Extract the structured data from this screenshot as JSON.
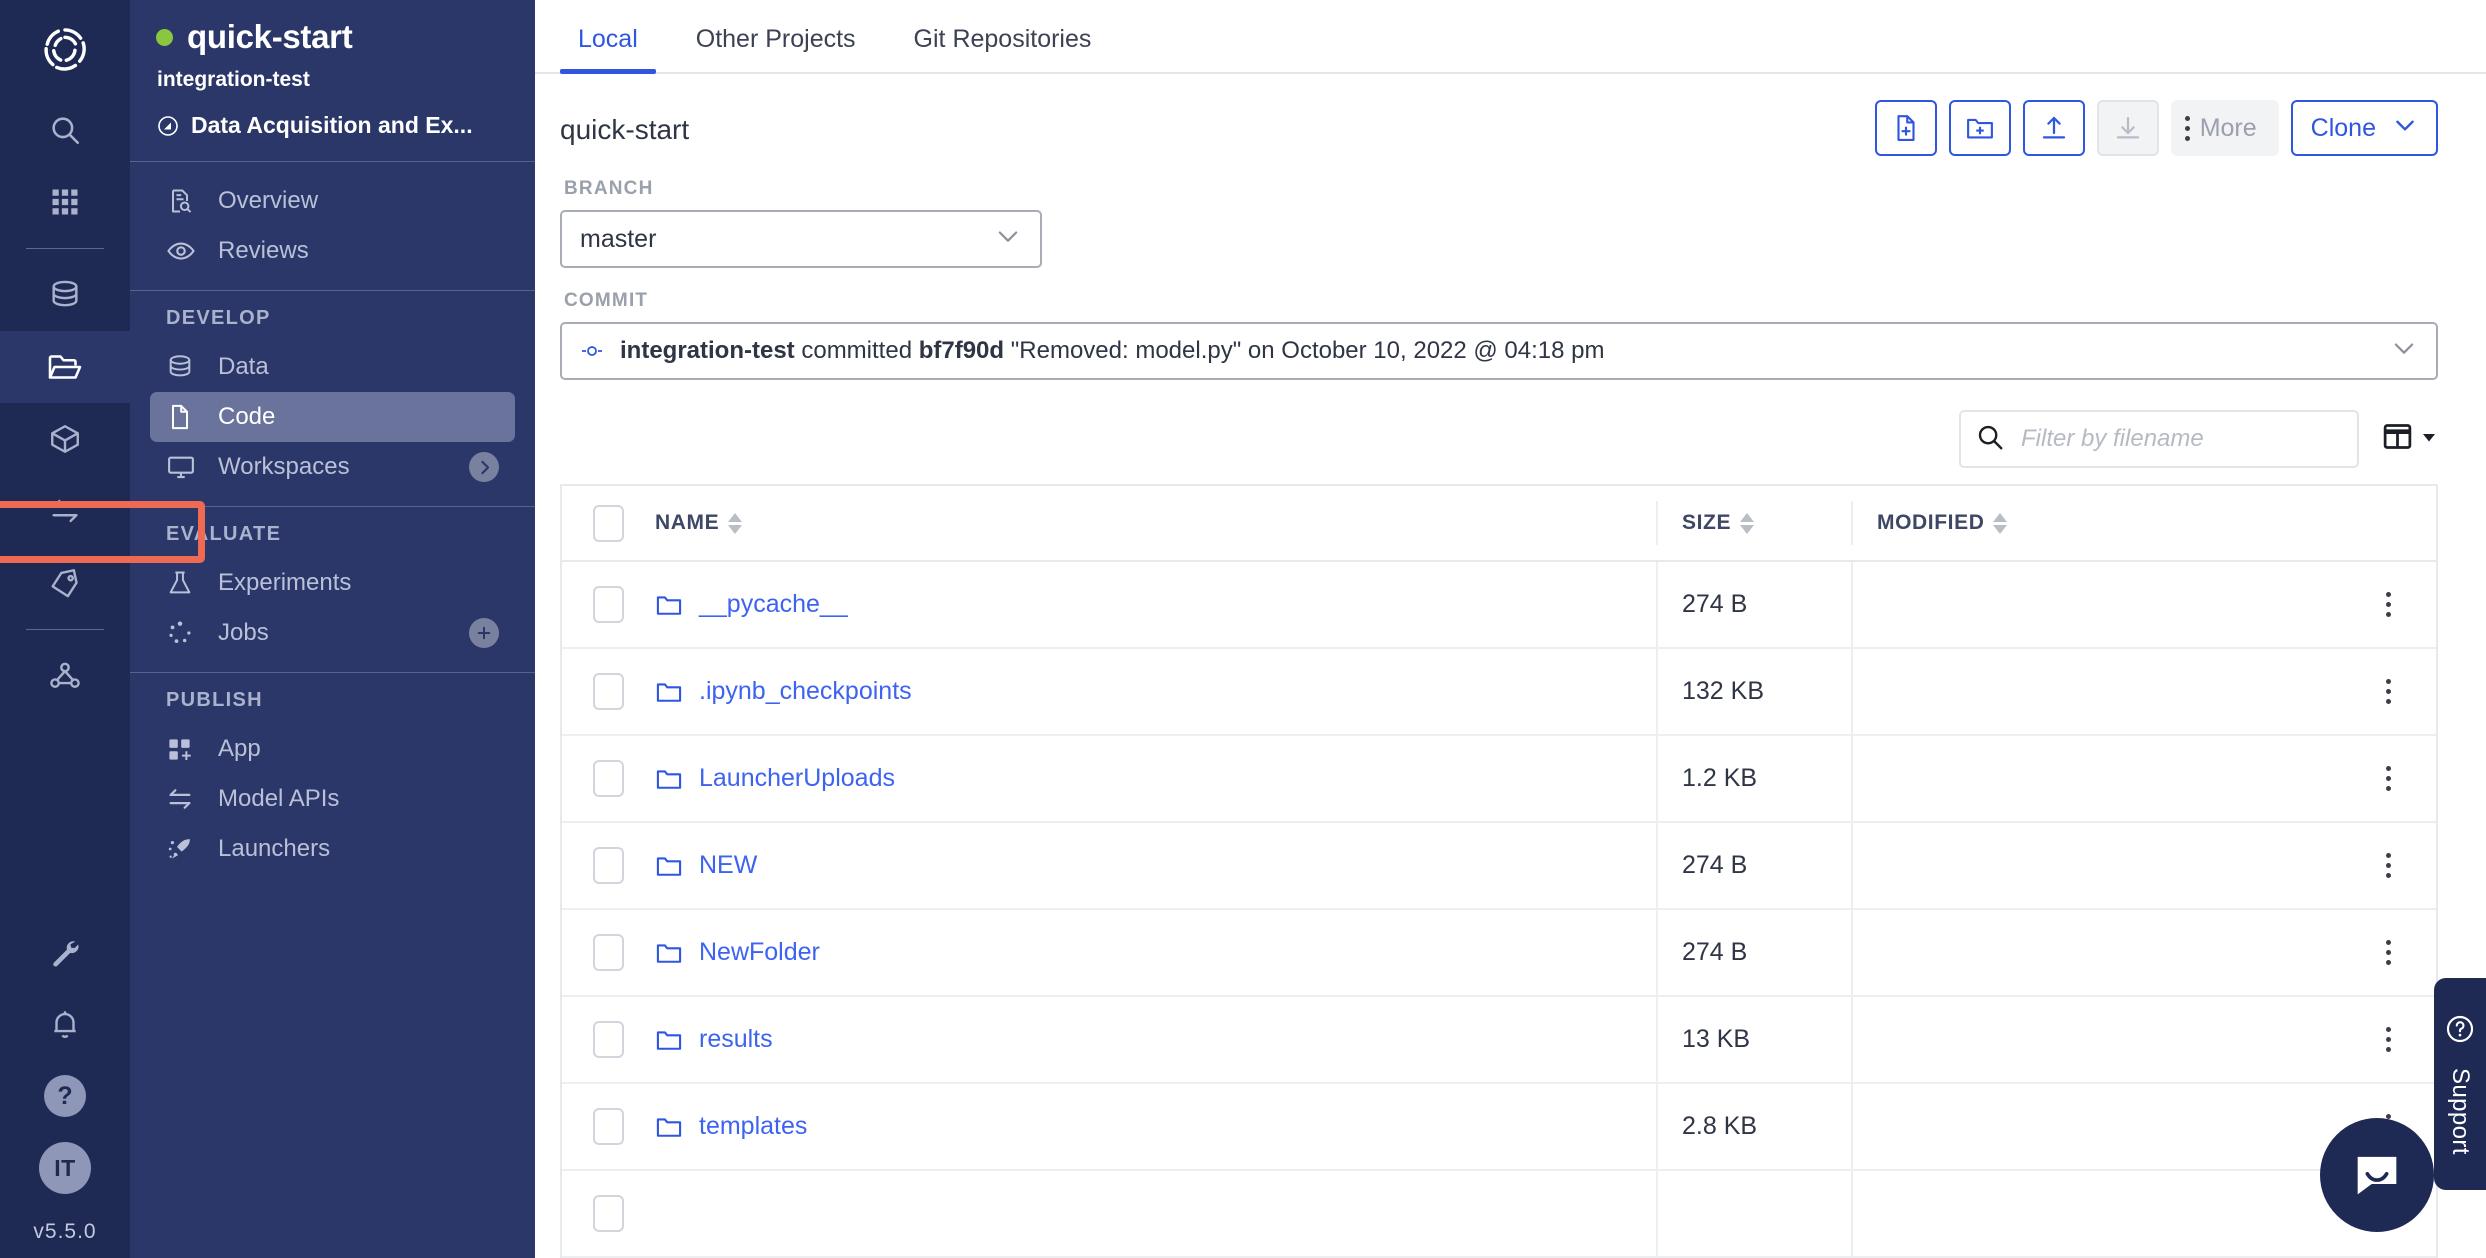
{
  "rail": {
    "version": "v5.5.0",
    "avatar_initials": "IT",
    "help_glyph": "?",
    "icons": [
      {
        "name": "domino-logo-icon",
        "label": "Domino"
      },
      {
        "name": "search-icon",
        "label": "Search"
      },
      {
        "name": "grid-apps-icon",
        "label": "Apps"
      },
      {
        "name": "database-icon",
        "label": "Data"
      },
      {
        "name": "folder-open-icon",
        "label": "Projects"
      },
      {
        "name": "cube-icon",
        "label": "Environments"
      },
      {
        "name": "transfer-arrows-icon",
        "label": "Model APIs"
      },
      {
        "name": "tag-icon",
        "label": "Tags"
      },
      {
        "name": "network-nodes-icon",
        "label": "Deployments"
      },
      {
        "name": "wrench-icon",
        "label": "Admin"
      },
      {
        "name": "bell-icon",
        "label": "Notifications"
      }
    ]
  },
  "sidebar": {
    "project_name": "quick-start",
    "owner": "integration-test",
    "datasource": "Data Acquisition and Ex...",
    "status_color": "#8ac63f",
    "top_items": [
      {
        "label": "Overview",
        "icon": "document-search-icon"
      },
      {
        "label": "Reviews",
        "icon": "eye-icon"
      }
    ],
    "groups": [
      {
        "title": "DEVELOP",
        "items": [
          {
            "label": "Data",
            "icon": "database-icon",
            "badge": null,
            "selected": false
          },
          {
            "label": "Code",
            "icon": "file-icon",
            "badge": null,
            "selected": true
          },
          {
            "label": "Workspaces",
            "icon": "monitor-icon",
            "badge": "chevron-right",
            "selected": false
          }
        ]
      },
      {
        "title": "EVALUATE",
        "items": [
          {
            "label": "Experiments",
            "icon": "flask-icon",
            "badge": null,
            "selected": false
          },
          {
            "label": "Jobs",
            "icon": "dots-spinner-icon",
            "badge": "plus",
            "selected": false
          }
        ]
      },
      {
        "title": "PUBLISH",
        "items": [
          {
            "label": "App",
            "icon": "app-grid-plus-icon",
            "badge": null,
            "selected": false
          },
          {
            "label": "Model APIs",
            "icon": "transfer-arrows-icon",
            "badge": null,
            "selected": false
          },
          {
            "label": "Launchers",
            "icon": "rocket-icon",
            "badge": null,
            "selected": false
          }
        ]
      }
    ],
    "annotation_color": "#ef6a53"
  },
  "tabs": [
    {
      "label": "Local",
      "active": true
    },
    {
      "label": "Other Projects",
      "active": false
    },
    {
      "label": "Git Repositories",
      "active": false
    }
  ],
  "header": {
    "page_title": "quick-start",
    "more_label": "More",
    "clone_label": "Clone",
    "buttons": [
      {
        "name": "new-file-button",
        "icon": "file-plus-icon",
        "disabled": false
      },
      {
        "name": "new-folder-button",
        "icon": "folder-plus-icon",
        "disabled": false
      },
      {
        "name": "upload-button",
        "icon": "upload-icon",
        "disabled": false
      },
      {
        "name": "download-button",
        "icon": "download-icon",
        "disabled": true
      }
    ],
    "accent_color": "#2f56e0"
  },
  "branch": {
    "label": "BRANCH",
    "value": "master"
  },
  "commit": {
    "label": "COMMIT",
    "author": "integration-test",
    "verb": "committed",
    "hash": "bf7f90d",
    "message": "\"Removed: model.py\"",
    "when": "on October 10, 2022 @ 04:18 pm"
  },
  "filter": {
    "placeholder": "Filter by filename",
    "value": ""
  },
  "table": {
    "columns": [
      {
        "key": "name",
        "label": "NAME",
        "sortable": true
      },
      {
        "key": "size",
        "label": "SIZE",
        "sortable": true
      },
      {
        "key": "modified",
        "label": "MODIFIED",
        "sortable": true
      }
    ],
    "rows": [
      {
        "name": "__pycache__",
        "size": "274 B",
        "modified": "",
        "type": "folder"
      },
      {
        "name": ".ipynb_checkpoints",
        "size": "132 KB",
        "modified": "",
        "type": "folder"
      },
      {
        "name": "LauncherUploads",
        "size": "1.2 KB",
        "modified": "",
        "type": "folder"
      },
      {
        "name": "NEW",
        "size": "274 B",
        "modified": "",
        "type": "folder"
      },
      {
        "name": "NewFolder",
        "size": "274 B",
        "modified": "",
        "type": "folder"
      },
      {
        "name": "results",
        "size": "13 KB",
        "modified": "",
        "type": "folder"
      },
      {
        "name": "templates",
        "size": "2.8 KB",
        "modified": "",
        "type": "folder"
      }
    ]
  },
  "support": {
    "label": "Support",
    "help_glyph": "?"
  }
}
